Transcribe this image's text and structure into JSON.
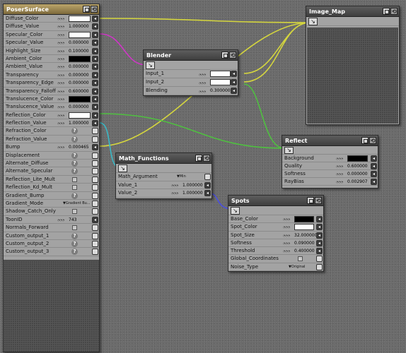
{
  "colors": {
    "wire_yellow": "#d5d63e",
    "wire_magenta": "#cf36c6",
    "wire_green": "#4fc040",
    "wire_cyan": "#39b9c6",
    "wire_blue": "#4b4fe0",
    "title_bar": "#4a4a4a",
    "title_bar_root": "#9e8955",
    "node_body": "#a3a3a3"
  },
  "poser_surface": {
    "title": "PoserSurface",
    "rows": [
      {
        "label": "Diffuse_Color",
        "kind": "swatch",
        "color": "white"
      },
      {
        "label": "Diffuse_Value",
        "kind": "value",
        "value": "1.000000"
      },
      {
        "label": "Specular_Color",
        "kind": "swatch",
        "color": "white"
      },
      {
        "label": "Specular_Value",
        "kind": "value",
        "value": "0.000000"
      },
      {
        "label": "Highlight_Size",
        "kind": "value",
        "value": "0.100000"
      },
      {
        "label": "Ambient_Color",
        "kind": "swatch",
        "color": "black"
      },
      {
        "label": "Ambient_Value",
        "kind": "value",
        "value": "0.000000"
      },
      {
        "label": "Transparency",
        "kind": "value",
        "value": "0.000000"
      },
      {
        "label": "Transparency_Edge",
        "kind": "value",
        "value": "0.000000"
      },
      {
        "label": "Transparency_Falloff",
        "kind": "value",
        "value": "0.600000"
      },
      {
        "label": "Translucence_Color",
        "kind": "swatch",
        "color": "black"
      },
      {
        "label": "Translucence_Value",
        "kind": "value",
        "value": "0.000000"
      },
      {
        "label": "Reflection_Color",
        "kind": "swatch",
        "color": "white"
      },
      {
        "label": "Reflection_Value",
        "kind": "value",
        "value": "1.000000"
      },
      {
        "label": "Refraction_Color",
        "kind": "help"
      },
      {
        "label": "Refraction_Value",
        "kind": "help"
      },
      {
        "label": "Bump",
        "kind": "value",
        "value": "0.000465"
      },
      {
        "label": "Displacement",
        "kind": "help"
      },
      {
        "label": "Alternate_Diffuse",
        "kind": "help"
      },
      {
        "label": "Alternate_Specular",
        "kind": "help"
      },
      {
        "label": "Reflection_Lite_Mult",
        "kind": "check"
      },
      {
        "label": "Reflection_Kd_Mult",
        "kind": "check"
      },
      {
        "label": "Gradient_Bump",
        "kind": "help"
      },
      {
        "label": "Gradient_Mode",
        "kind": "dropdown",
        "value": "Gradient Bu..."
      },
      {
        "label": "Shadow_Catch_Only",
        "kind": "check"
      },
      {
        "label": "ToonID",
        "kind": "value",
        "value": "743"
      },
      {
        "label": "Normals_Forward",
        "kind": "check"
      },
      {
        "label": "Custom_output_1",
        "kind": "help"
      },
      {
        "label": "Custom_output_2",
        "kind": "help"
      },
      {
        "label": "Custom_output_3",
        "kind": "help"
      }
    ]
  },
  "image_map": {
    "title": "Image_Map"
  },
  "blender": {
    "title": "Blender",
    "rows": [
      {
        "label": "Input_1",
        "kind": "swatch",
        "color": "white"
      },
      {
        "label": "Input_2",
        "kind": "swatch",
        "color": "white"
      },
      {
        "label": "Blending",
        "kind": "value",
        "value": "0.300000"
      }
    ]
  },
  "reflect": {
    "title": "Reflect",
    "rows": [
      {
        "label": "Background",
        "kind": "swatch",
        "color": "black"
      },
      {
        "label": "Quality",
        "kind": "value",
        "value": "0.600000"
      },
      {
        "label": "Softness",
        "kind": "value",
        "value": "0.000000"
      },
      {
        "label": "RayBias",
        "kind": "value",
        "value": "0.002907"
      }
    ]
  },
  "math_functions": {
    "title": "Math_Functions",
    "rows": [
      {
        "label": "Math_Argument",
        "kind": "dropdown",
        "value": "Min"
      },
      {
        "label": "Value_1",
        "kind": "value",
        "value": "1.000000"
      },
      {
        "label": "Value_2",
        "kind": "value",
        "value": "1.000000"
      }
    ]
  },
  "spots": {
    "title": "Spots",
    "rows": [
      {
        "label": "Base_Color",
        "kind": "swatch",
        "color": "black"
      },
      {
        "label": "Spot_Color",
        "kind": "swatch",
        "color": "white"
      },
      {
        "label": "Spot_Size",
        "kind": "value",
        "value": "32.000000"
      },
      {
        "label": "Softness",
        "kind": "value",
        "value": "0.090000"
      },
      {
        "label": "Threshold",
        "kind": "value",
        "value": "0.400000"
      },
      {
        "label": "Global_Coordinates",
        "kind": "check"
      },
      {
        "label": "Noise_Type",
        "kind": "dropdown",
        "value": "Original"
      }
    ]
  }
}
